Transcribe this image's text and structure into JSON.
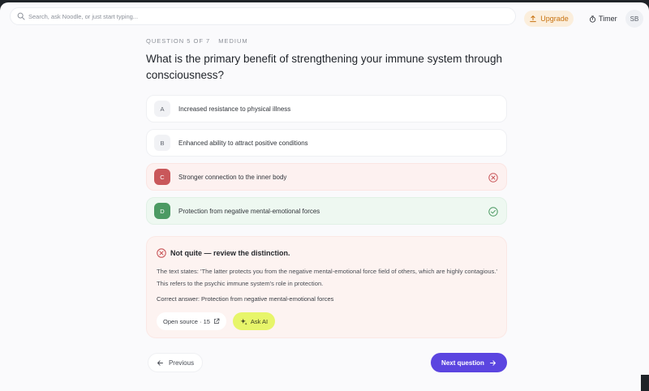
{
  "search": {
    "placeholder": "Search, ask Noodle, or just start typing..."
  },
  "header": {
    "upgrade_label": "Upgrade",
    "timer_label": "Timer",
    "avatar_initials": "SB"
  },
  "quiz": {
    "progress": "QUESTION 5 OF 7",
    "difficulty": "MEDIUM",
    "question": "What is the primary benefit of strengthening your immune system through consciousness?",
    "options": [
      {
        "letter": "A",
        "text": "Increased resistance to physical illness",
        "state": "neutral"
      },
      {
        "letter": "B",
        "text": "Enhanced ability to attract positive conditions",
        "state": "neutral"
      },
      {
        "letter": "C",
        "text": "Stronger connection to the inner body",
        "state": "wrong"
      },
      {
        "letter": "D",
        "text": "Protection from negative mental-emotional forces",
        "state": "correct"
      }
    ]
  },
  "feedback": {
    "title": "Not quite — review the distinction.",
    "explanation": "The text states: 'The latter protects you from the negative mental-emotional force field of others, which are highly contagious.' This refers to the psychic immune system's role in protection.",
    "correct_answer": "Correct answer: Protection from negative mental-emotional forces",
    "source_label": "Open source · 15",
    "ask_ai_label": "Ask AI"
  },
  "nav": {
    "previous_label": "Previous",
    "next_label": "Next question"
  },
  "colors": {
    "accent": "#5b45e0",
    "wrong": "#c9575a",
    "correct": "#4c9a63",
    "upgrade": "#c8720f",
    "ask_ai": "#e7f56a"
  },
  "icons": [
    "search-icon",
    "upload-icon",
    "stopwatch-icon",
    "x-circle-icon",
    "check-circle-icon",
    "external-link-icon",
    "sparkle-icon",
    "arrow-left-icon",
    "arrow-right-icon"
  ]
}
